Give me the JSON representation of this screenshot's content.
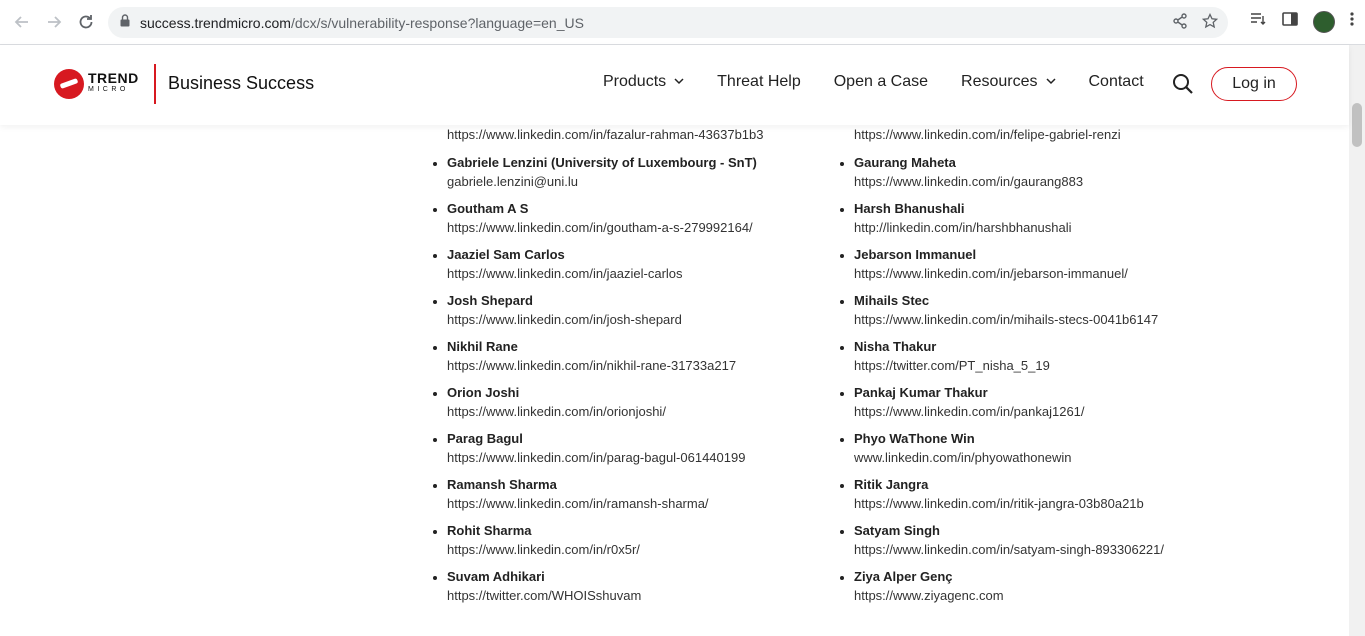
{
  "browser": {
    "url_host": "success.trendmicro.com",
    "url_path": "/dcx/s/vulnerability-response?language=en_US"
  },
  "header": {
    "logo_trend": "TREND",
    "logo_micro": "MICRO",
    "brand_title": "Business Success",
    "nav": [
      "Products",
      "Threat Help",
      "Open a Case",
      "Resources",
      "Contact"
    ],
    "login_label": "Log in",
    "accent_color": "#d71920"
  },
  "content": {
    "left_top_link": "https://www.linkedin.com/in/fazalur-rahman-43637b1b3",
    "right_top_link": "https://www.linkedin.com/in/felipe-gabriel-renzi",
    "left": [
      {
        "name": "Gabriele Lenzini (University of Luxembourg - SnT)",
        "link": "gabriele.lenzini@uni.lu"
      },
      {
        "name": "Goutham A S",
        "link": "https://www.linkedin.com/in/goutham-a-s-279992164/"
      },
      {
        "name": "Jaaziel Sam Carlos",
        "link": "https://www.linkedin.com/in/jaaziel-carlos"
      },
      {
        "name": "Josh Shepard",
        "link": "https://www.linkedin.com/in/josh-shepard"
      },
      {
        "name": "Nikhil Rane",
        "link": "https://www.linkedin.com/in/nikhil-rane-31733a217"
      },
      {
        "name": "Orion Joshi",
        "link": "https://www.linkedin.com/in/orionjoshi/"
      },
      {
        "name": "Parag Bagul",
        "link": "https://www.linkedin.com/in/parag-bagul-061440199"
      },
      {
        "name": "Ramansh Sharma",
        "link": "https://www.linkedin.com/in/ramansh-sharma/"
      },
      {
        "name": "Rohit Sharma",
        "link": "https://www.linkedin.com/in/r0x5r/"
      },
      {
        "name": "Suvam Adhikari",
        "link": "https://twitter.com/WHOISshuvam"
      }
    ],
    "right": [
      {
        "name": "Gaurang Maheta",
        "link": "https://www.linkedin.com/in/gaurang883"
      },
      {
        "name": "Harsh Bhanushali",
        "link": "http://linkedin.com/in/harshbhanushali"
      },
      {
        "name": "Jebarson Immanuel",
        "link": "https://www.linkedin.com/in/jebarson-immanuel/"
      },
      {
        "name": "Mihails Stec",
        "link": "https://www.linkedin.com/in/mihails-stecs-0041b6147"
      },
      {
        "name": "Nisha Thakur",
        "link": "https://twitter.com/PT_nisha_5_19"
      },
      {
        "name": "Pankaj Kumar Thakur",
        "link": "https://www.linkedin.com/in/pankaj1261/"
      },
      {
        "name": "Phyo WaThone Win",
        "link": "www.linkedin.com/in/phyowathonewin"
      },
      {
        "name": "Ritik Jangra",
        "link": "https://www.linkedin.com/in/ritik-jangra-03b80a21b"
      },
      {
        "name": "Satyam Singh",
        "link": "https://www.linkedin.com/in/satyam-singh-893306221/"
      },
      {
        "name": "Ziya Alper Genç",
        "link": "https://www.ziyagenc.com"
      }
    ]
  }
}
